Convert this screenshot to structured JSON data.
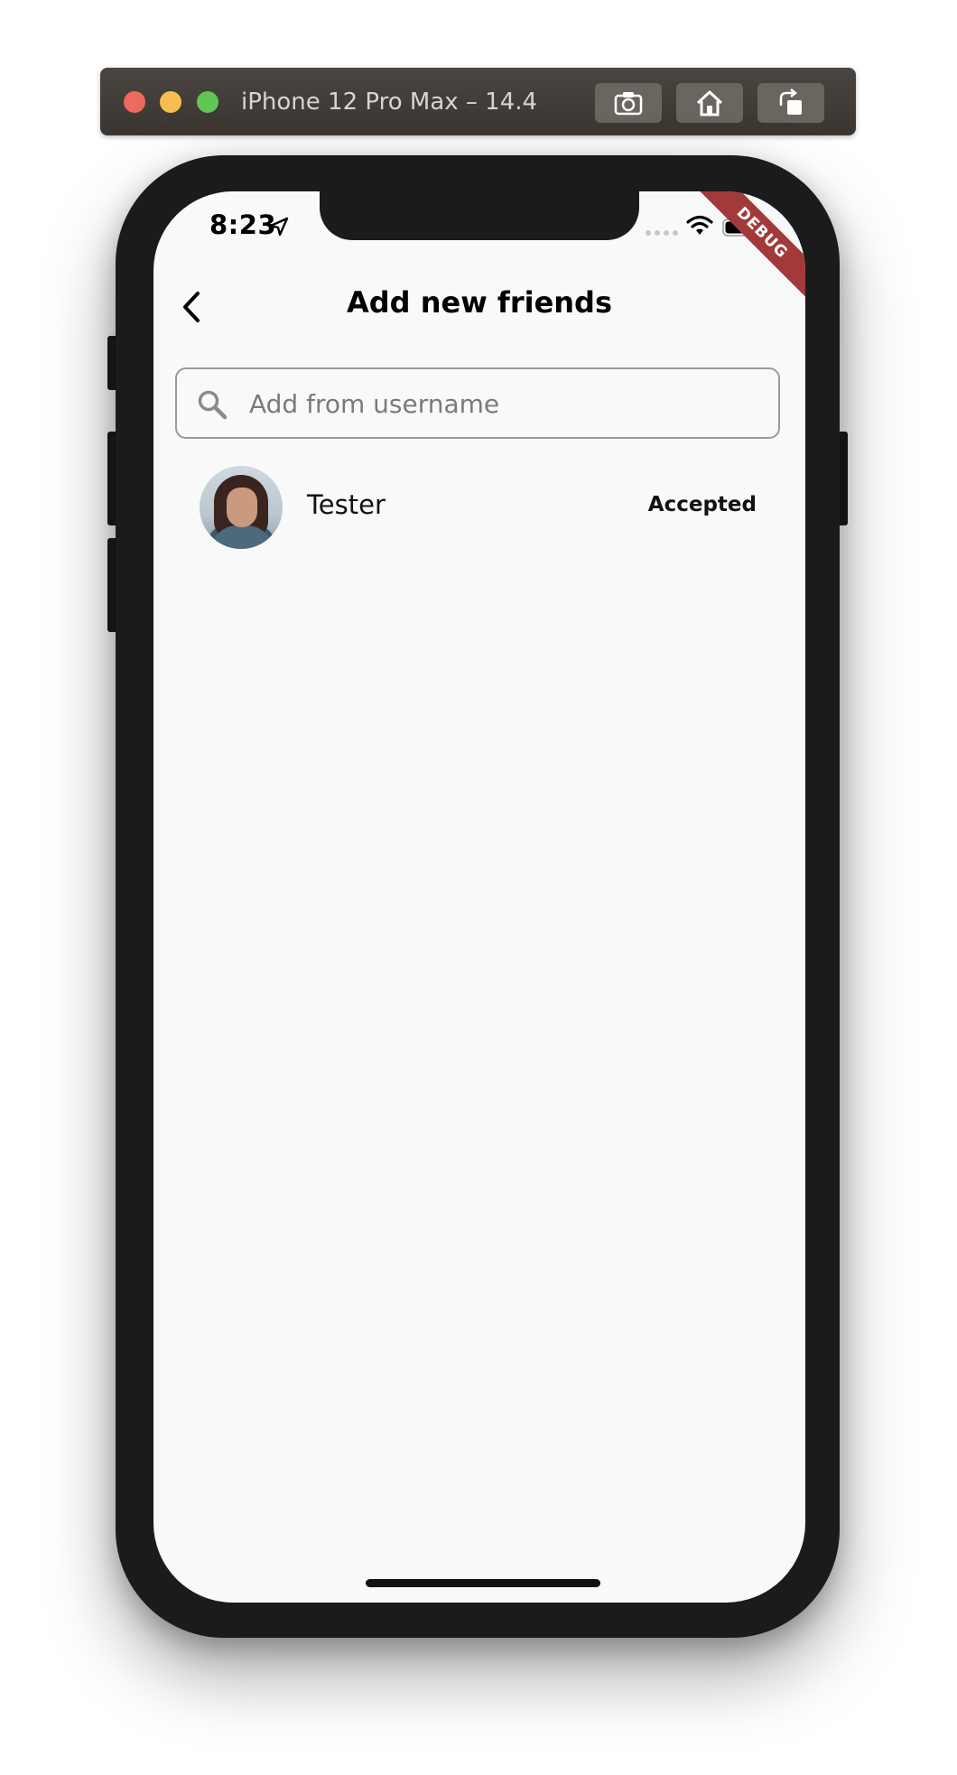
{
  "simulator": {
    "title": "iPhone 12 Pro Max – 14.4",
    "buttons": [
      "camera-icon",
      "home-icon",
      "rotate-icon"
    ]
  },
  "status_bar": {
    "time": "8:23"
  },
  "debug_banner": "DEBUG",
  "app_bar": {
    "title": "Add new friends"
  },
  "search": {
    "placeholder": "Add from username",
    "value": ""
  },
  "friends": [
    {
      "name": "Tester",
      "status": "Accepted"
    }
  ],
  "colors": {
    "screen_bg": "#f9f9f9",
    "debug_ribbon": "#a33a3a",
    "phone_frame": "#1b1b1b"
  }
}
